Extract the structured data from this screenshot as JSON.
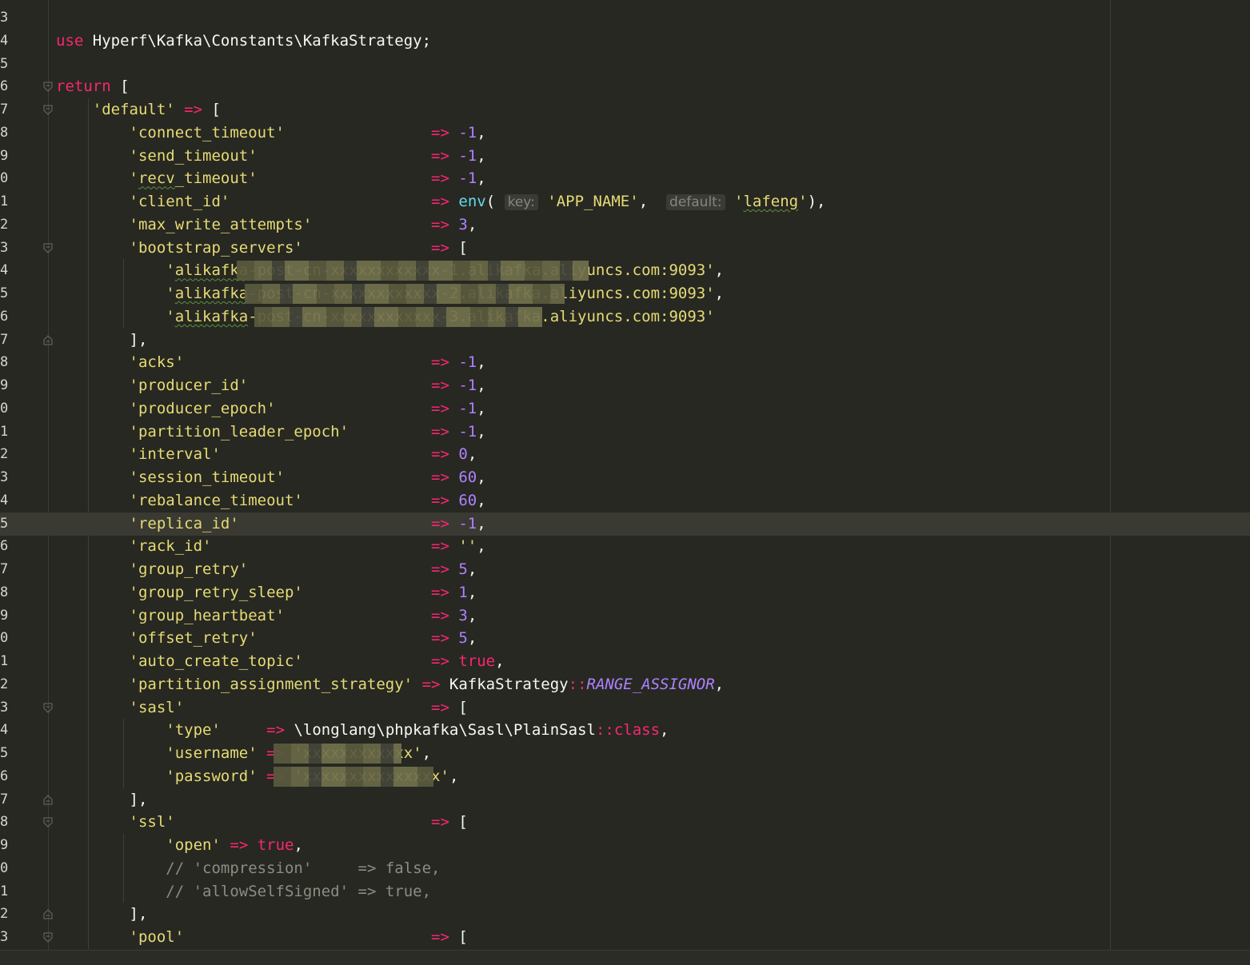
{
  "editor": {
    "lines": [
      {
        "n": "3",
        "tokens": []
      },
      {
        "n": "4",
        "tokens": [
          [
            "kw",
            "use"
          ],
          [
            "plain",
            " Hyperf\\Kafka\\Constants\\KafkaStrategy;"
          ]
        ]
      },
      {
        "n": "5",
        "tokens": []
      },
      {
        "n": "6",
        "tokens": [
          [
            "kw",
            "return"
          ],
          [
            "plain",
            " ["
          ]
        ]
      },
      {
        "n": "7",
        "tokens": [
          [
            "plain",
            "    "
          ],
          [
            "str",
            "'default'"
          ],
          [
            "plain",
            " "
          ],
          [
            "op",
            "=>"
          ],
          [
            "plain",
            " ["
          ]
        ]
      },
      {
        "n": "8",
        "tokens": [
          [
            "plain",
            "        "
          ],
          [
            "str",
            "'connect_timeout'"
          ],
          [
            "plain",
            "                "
          ],
          [
            "op",
            "=>"
          ],
          [
            "plain",
            " "
          ],
          [
            "num",
            "-1"
          ],
          [
            "plain",
            ","
          ]
        ]
      },
      {
        "n": "9",
        "tokens": [
          [
            "plain",
            "        "
          ],
          [
            "str",
            "'send_timeout'"
          ],
          [
            "plain",
            "                   "
          ],
          [
            "op",
            "=>"
          ],
          [
            "plain",
            " "
          ],
          [
            "num",
            "-1"
          ],
          [
            "plain",
            ","
          ]
        ]
      },
      {
        "n": "0",
        "tokens": [
          [
            "plain",
            "        "
          ],
          [
            "str",
            "'"
          ],
          [
            "strsq",
            "recv"
          ],
          [
            "str",
            "_timeout'"
          ],
          [
            "plain",
            "                   "
          ],
          [
            "op",
            "=>"
          ],
          [
            "plain",
            " "
          ],
          [
            "num",
            "-1"
          ],
          [
            "plain",
            ","
          ]
        ]
      },
      {
        "n": "1",
        "tokens": [
          [
            "plain",
            "        "
          ],
          [
            "str",
            "'client_id'"
          ],
          [
            "plain",
            "                      "
          ],
          [
            "op",
            "=>"
          ],
          [
            "plain",
            " "
          ],
          [
            "fn",
            "env"
          ],
          [
            "plain",
            "( "
          ],
          [
            "hint",
            "key:"
          ],
          [
            "plain",
            " "
          ],
          [
            "str",
            "'APP_NAME'"
          ],
          [
            "plain",
            ", "
          ],
          [
            "plain",
            " "
          ],
          [
            "hint",
            "default:"
          ],
          [
            "plain",
            " "
          ],
          [
            "str",
            "'"
          ],
          [
            "strsq",
            "lafeng"
          ],
          [
            "str",
            "'"
          ],
          [
            "plain",
            "),"
          ]
        ]
      },
      {
        "n": "2",
        "tokens": [
          [
            "plain",
            "        "
          ],
          [
            "str",
            "'max_write_attempts'"
          ],
          [
            "plain",
            "             "
          ],
          [
            "op",
            "=>"
          ],
          [
            "plain",
            " "
          ],
          [
            "num",
            "3"
          ],
          [
            "plain",
            ","
          ]
        ]
      },
      {
        "n": "3",
        "tokens": [
          [
            "plain",
            "        "
          ],
          [
            "str",
            "'bootstrap_servers'"
          ],
          [
            "plain",
            "              "
          ],
          [
            "op",
            "=>"
          ],
          [
            "plain",
            " ["
          ]
        ]
      },
      {
        "n": "4",
        "tokens": [
          [
            "plain",
            "            "
          ],
          [
            "str",
            "'"
          ],
          [
            "strsq",
            "alikafka"
          ],
          [
            "str",
            "-post-cn-xxxxxxxxxxxx-1.alikafka.aliyuncs.com:9093'"
          ],
          [
            "plain",
            ","
          ]
        ]
      },
      {
        "n": "5",
        "tokens": [
          [
            "plain",
            "            "
          ],
          [
            "str",
            "'"
          ],
          [
            "strsq",
            "alikafka"
          ],
          [
            "str",
            "-post-cn-xxxxxxxxxxxx-2.alikafka.aliyuncs.com:9093'"
          ],
          [
            "plain",
            ","
          ]
        ]
      },
      {
        "n": "6",
        "tokens": [
          [
            "plain",
            "            "
          ],
          [
            "str",
            "'"
          ],
          [
            "strsq",
            "alikafka"
          ],
          [
            "str",
            "-post-cn-xxxxxxxxxxxx-3.alikafka.aliyuncs.com:9093'"
          ]
        ]
      },
      {
        "n": "7",
        "tokens": [
          [
            "plain",
            "        ],"
          ]
        ]
      },
      {
        "n": "8",
        "tokens": [
          [
            "plain",
            "        "
          ],
          [
            "str",
            "'acks'"
          ],
          [
            "plain",
            "                           "
          ],
          [
            "op",
            "=>"
          ],
          [
            "plain",
            " "
          ],
          [
            "num",
            "-1"
          ],
          [
            "plain",
            ","
          ]
        ]
      },
      {
        "n": "9",
        "tokens": [
          [
            "plain",
            "        "
          ],
          [
            "str",
            "'producer_id'"
          ],
          [
            "plain",
            "                    "
          ],
          [
            "op",
            "=>"
          ],
          [
            "plain",
            " "
          ],
          [
            "num",
            "-1"
          ],
          [
            "plain",
            ","
          ]
        ]
      },
      {
        "n": "0",
        "tokens": [
          [
            "plain",
            "        "
          ],
          [
            "str",
            "'producer_epoch'"
          ],
          [
            "plain",
            "                 "
          ],
          [
            "op",
            "=>"
          ],
          [
            "plain",
            " "
          ],
          [
            "num",
            "-1"
          ],
          [
            "plain",
            ","
          ]
        ]
      },
      {
        "n": "1",
        "tokens": [
          [
            "plain",
            "        "
          ],
          [
            "str",
            "'partition_leader_epoch'"
          ],
          [
            "plain",
            "         "
          ],
          [
            "op",
            "=>"
          ],
          [
            "plain",
            " "
          ],
          [
            "num",
            "-1"
          ],
          [
            "plain",
            ","
          ]
        ]
      },
      {
        "n": "2",
        "tokens": [
          [
            "plain",
            "        "
          ],
          [
            "str",
            "'interval'"
          ],
          [
            "plain",
            "                       "
          ],
          [
            "op",
            "=>"
          ],
          [
            "plain",
            " "
          ],
          [
            "num",
            "0"
          ],
          [
            "plain",
            ","
          ]
        ]
      },
      {
        "n": "3",
        "tokens": [
          [
            "plain",
            "        "
          ],
          [
            "str",
            "'session_timeout'"
          ],
          [
            "plain",
            "                "
          ],
          [
            "op",
            "=>"
          ],
          [
            "plain",
            " "
          ],
          [
            "num",
            "60"
          ],
          [
            "plain",
            ","
          ]
        ]
      },
      {
        "n": "4",
        "tokens": [
          [
            "plain",
            "        "
          ],
          [
            "str",
            "'rebalance_timeout'"
          ],
          [
            "plain",
            "              "
          ],
          [
            "op",
            "=>"
          ],
          [
            "plain",
            " "
          ],
          [
            "num",
            "60"
          ],
          [
            "plain",
            ","
          ]
        ]
      },
      {
        "n": "5",
        "tokens": [
          [
            "plain",
            "        "
          ],
          [
            "str",
            "'replica_id'"
          ],
          [
            "plain",
            "                     "
          ],
          [
            "op",
            "=>"
          ],
          [
            "plain",
            " "
          ],
          [
            "num",
            "-1"
          ],
          [
            "plain",
            ","
          ]
        ],
        "current": true
      },
      {
        "n": "6",
        "tokens": [
          [
            "plain",
            "        "
          ],
          [
            "str",
            "'rack_id'"
          ],
          [
            "plain",
            "                        "
          ],
          [
            "op",
            "=>"
          ],
          [
            "plain",
            " "
          ],
          [
            "str",
            "''"
          ],
          [
            "plain",
            ","
          ]
        ]
      },
      {
        "n": "7",
        "tokens": [
          [
            "plain",
            "        "
          ],
          [
            "str",
            "'group_retry'"
          ],
          [
            "plain",
            "                    "
          ],
          [
            "op",
            "=>"
          ],
          [
            "plain",
            " "
          ],
          [
            "num",
            "5"
          ],
          [
            "plain",
            ","
          ]
        ]
      },
      {
        "n": "8",
        "tokens": [
          [
            "plain",
            "        "
          ],
          [
            "str",
            "'group_retry_sleep'"
          ],
          [
            "plain",
            "              "
          ],
          [
            "op",
            "=>"
          ],
          [
            "plain",
            " "
          ],
          [
            "num",
            "1"
          ],
          [
            "plain",
            ","
          ]
        ]
      },
      {
        "n": "9",
        "tokens": [
          [
            "plain",
            "        "
          ],
          [
            "str",
            "'group_heartbeat'"
          ],
          [
            "plain",
            "                "
          ],
          [
            "op",
            "=>"
          ],
          [
            "plain",
            " "
          ],
          [
            "num",
            "3"
          ],
          [
            "plain",
            ","
          ]
        ]
      },
      {
        "n": "0",
        "tokens": [
          [
            "plain",
            "        "
          ],
          [
            "str",
            "'offset_retry'"
          ],
          [
            "plain",
            "                   "
          ],
          [
            "op",
            "=>"
          ],
          [
            "plain",
            " "
          ],
          [
            "num",
            "5"
          ],
          [
            "plain",
            ","
          ]
        ]
      },
      {
        "n": "1",
        "tokens": [
          [
            "plain",
            "        "
          ],
          [
            "str",
            "'auto_create_topic'"
          ],
          [
            "plain",
            "              "
          ],
          [
            "op",
            "=>"
          ],
          [
            "plain",
            " "
          ],
          [
            "kw",
            "true"
          ],
          [
            "plain",
            ","
          ]
        ]
      },
      {
        "n": "2",
        "tokens": [
          [
            "plain",
            "        "
          ],
          [
            "str",
            "'partition_assignment_strategy'"
          ],
          [
            "plain",
            " "
          ],
          [
            "op",
            "=>"
          ],
          [
            "plain",
            " KafkaStrategy"
          ],
          [
            "op",
            "::"
          ],
          [
            "const",
            "RANGE_ASSIGNOR"
          ],
          [
            "plain",
            ","
          ]
        ]
      },
      {
        "n": "3",
        "tokens": [
          [
            "plain",
            "        "
          ],
          [
            "str",
            "'sasl'"
          ],
          [
            "plain",
            "                           "
          ],
          [
            "op",
            "=>"
          ],
          [
            "plain",
            " ["
          ]
        ]
      },
      {
        "n": "4",
        "tokens": [
          [
            "plain",
            "            "
          ],
          [
            "str",
            "'type'"
          ],
          [
            "plain",
            "     "
          ],
          [
            "op",
            "=>"
          ],
          [
            "plain",
            " \\longlang\\phpkafka\\Sasl\\PlainSasl"
          ],
          [
            "op",
            "::"
          ],
          [
            "kw",
            "class"
          ],
          [
            "plain",
            ","
          ]
        ]
      },
      {
        "n": "5",
        "tokens": [
          [
            "plain",
            "            "
          ],
          [
            "str",
            "'username'"
          ],
          [
            "plain",
            " "
          ],
          [
            "op",
            "=>"
          ],
          [
            "plain",
            " "
          ],
          [
            "str",
            "'xxxxxxxxxxxx'"
          ],
          [
            "plain",
            ","
          ]
        ]
      },
      {
        "n": "6",
        "tokens": [
          [
            "plain",
            "            "
          ],
          [
            "str",
            "'password'"
          ],
          [
            "plain",
            " "
          ],
          [
            "op",
            "=>"
          ],
          [
            "plain",
            " "
          ],
          [
            "str",
            "'xxxxxxxxxxxxxxx'"
          ],
          [
            "plain",
            ","
          ]
        ]
      },
      {
        "n": "7",
        "tokens": [
          [
            "plain",
            "        ],"
          ]
        ]
      },
      {
        "n": "8",
        "tokens": [
          [
            "plain",
            "        "
          ],
          [
            "str",
            "'ssl'"
          ],
          [
            "plain",
            "                            "
          ],
          [
            "op",
            "=>"
          ],
          [
            "plain",
            " ["
          ]
        ]
      },
      {
        "n": "9",
        "tokens": [
          [
            "plain",
            "            "
          ],
          [
            "str",
            "'open'"
          ],
          [
            "plain",
            " "
          ],
          [
            "op",
            "=>"
          ],
          [
            "plain",
            " "
          ],
          [
            "kw",
            "true"
          ],
          [
            "plain",
            ","
          ]
        ]
      },
      {
        "n": "0",
        "tokens": [
          [
            "plain",
            "            "
          ],
          [
            "cmt",
            "// 'compression'     => false,"
          ]
        ]
      },
      {
        "n": "1",
        "tokens": [
          [
            "plain",
            "            "
          ],
          [
            "cmt",
            "// 'allowSelfSigned' => true,"
          ]
        ]
      },
      {
        "n": "2",
        "tokens": [
          [
            "plain",
            "        ],"
          ]
        ]
      },
      {
        "n": "3",
        "tokens": [
          [
            "plain",
            "        "
          ],
          [
            "str",
            "'pool'"
          ],
          [
            "plain",
            "                           "
          ],
          [
            "op",
            "=>"
          ],
          [
            "plain",
            " ["
          ]
        ]
      }
    ],
    "folds": [
      {
        "line": 3,
        "kind": "open"
      },
      {
        "line": 4,
        "kind": "open"
      },
      {
        "line": 10,
        "kind": "open"
      },
      {
        "line": 14,
        "kind": "close"
      },
      {
        "line": 30,
        "kind": "open"
      },
      {
        "line": 34,
        "kind": "close"
      },
      {
        "line": 35,
        "kind": "open"
      },
      {
        "line": 39,
        "kind": "close"
      },
      {
        "line": 40,
        "kind": "open"
      }
    ],
    "redactions": [
      {
        "line": 11,
        "note": "bootstrap server 1 hidden"
      },
      {
        "line": 12,
        "note": "bootstrap server 2 hidden"
      },
      {
        "line": 13,
        "note": "bootstrap server 3 hidden"
      },
      {
        "line": 32,
        "note": "username hidden"
      },
      {
        "line": 33,
        "note": "password hidden"
      }
    ]
  }
}
